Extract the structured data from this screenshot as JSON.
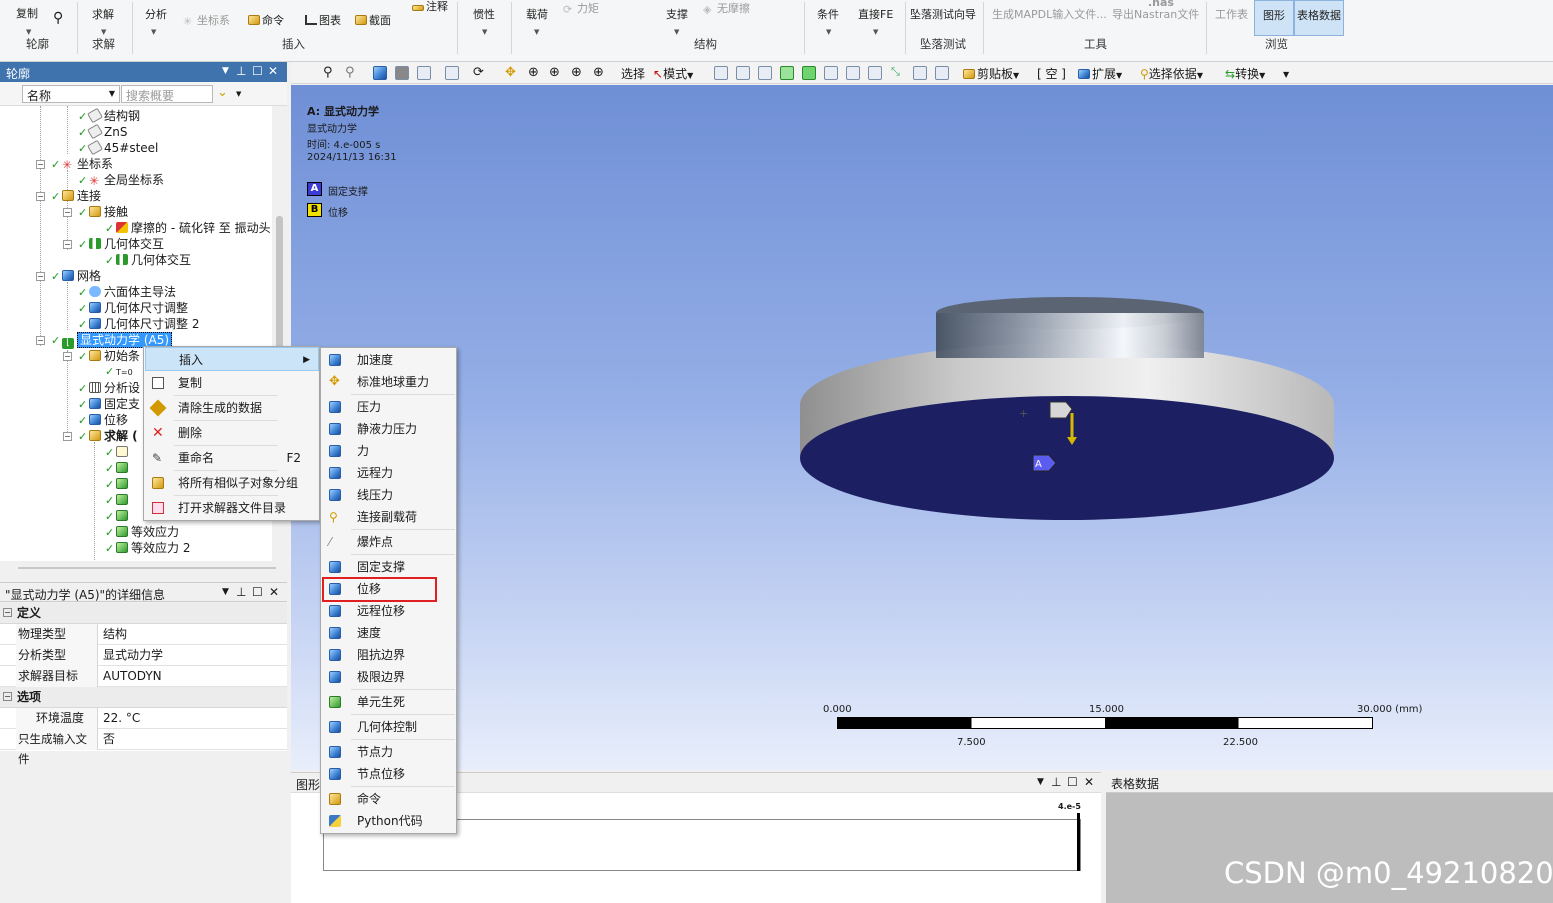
{
  "ribbon": {
    "copy": "复制",
    "outline_group": "轮廓",
    "solve": "求解",
    "solve_group": "求解",
    "analysis": "分析",
    "coordinate": "坐标系",
    "command": "命令",
    "chart": "图表",
    "section": "截面",
    "annotation": "注释",
    "insert_group": "插入",
    "inertia": "惯性",
    "load": "载荷",
    "moment": "力矩",
    "support": "支撑",
    "frictionless": "无摩擦",
    "structure_group": "结构",
    "condition": "条件",
    "direct_fe": "直接FE",
    "drop_test_wizard": "坠落测试向导",
    "drop_test_group": "坠落测试",
    "gen_mapdl": "生成MAPDL输入文件...",
    "nas": ".nas",
    "export_nastran": "导出Nastran文件",
    "tools_group": "工具",
    "worksheet": "工作表",
    "graphics": "图形",
    "table_data": "表格数据",
    "browse_group": "浏览"
  },
  "outline": {
    "title": "轮廓",
    "filter_label": "名称",
    "search_placeholder": "搜索概要",
    "tree": [
      "结构钢",
      "ZnS",
      "45#steel",
      "坐标系",
      "全局坐标系",
      "连接",
      "接触",
      "摩擦的 - 硫化锌 至 振动头",
      "几何体交互",
      "几何体交互",
      "网格",
      "六面体主导法",
      "几何体尺寸调整",
      "几何体尺寸调整 2",
      "显式动力学 (A5)",
      "初始条",
      "T=0",
      "分析设",
      "固定支",
      "位移",
      "求解 (",
      "等效应力",
      "等效应力 2"
    ]
  },
  "details": {
    "title": "\"显式动力学 (A5)\"的详细信息",
    "section_definition": "定义",
    "physics_type_label": "物理类型",
    "physics_type_value": "结构",
    "analysis_type_label": "分析类型",
    "analysis_type_value": "显式动力学",
    "solver_target_label": "求解器目标",
    "solver_target_value": "AUTODYN",
    "section_options": "选项",
    "env_temp_label": "环境温度",
    "env_temp_value": "22. °C",
    "gen_input_only_label": "只生成输入文件",
    "gen_input_only_value": "否"
  },
  "toolbar": {
    "select": "选择",
    "mode": "模式",
    "clipboard": "剪贴板",
    "empty": "[ 空 ]",
    "expand": "扩展",
    "select_by": "选择依据",
    "convert": "转换"
  },
  "viewport": {
    "title": "A: 显式动力学",
    "subtitle": "显式动力学",
    "time": "时间: 4.e-005 s",
    "date": "2024/11/13 16:31",
    "legend": [
      {
        "letter": "A",
        "label": "固定支撑",
        "color": "#3b3bd6"
      },
      {
        "letter": "B",
        "label": "位移",
        "color": "#f2e000"
      }
    ],
    "scale_top": [
      "0.000",
      "15.000",
      "30.000 (mm)"
    ],
    "scale_bottom": [
      "7.500",
      "22.500"
    ]
  },
  "context_menu": {
    "items": [
      {
        "label": "插入",
        "shortcut": ""
      },
      {
        "label": "复制",
        "shortcut": ""
      },
      {
        "label": "清除生成的数据",
        "shortcut": ""
      },
      {
        "label": "删除",
        "shortcut": ""
      },
      {
        "label": "重命名",
        "shortcut": "F2"
      },
      {
        "label": "将所有相似子对象分组",
        "shortcut": ""
      },
      {
        "label": "打开求解器文件目录",
        "shortcut": ""
      }
    ]
  },
  "submenu": {
    "items": [
      "加速度",
      "标准地球重力",
      "压力",
      "静液力压力",
      "力",
      "远程力",
      "线压力",
      "连接副载荷",
      "爆炸点",
      "固定支撑",
      "位移",
      "远程位移",
      "速度",
      "阻抗边界",
      "极限边界",
      "单元生死",
      "几何体控制",
      "节点力",
      "节点位移",
      "命令",
      "Python代码"
    ],
    "highlighted": "位移"
  },
  "bottom": {
    "graph_title": "图形",
    "graph_max": "4.e-5",
    "table_title": "表格数据"
  },
  "watermark": "CSDN @m0_49210820"
}
